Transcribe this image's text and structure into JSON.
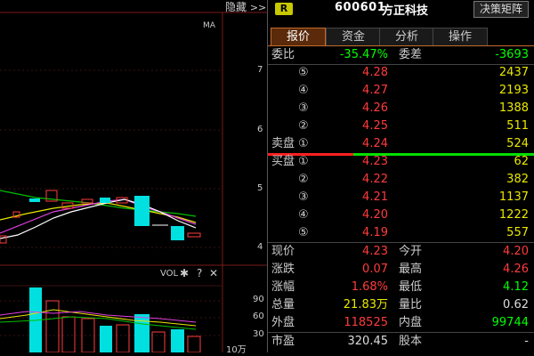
{
  "chart": {
    "hide_label": "隐藏",
    "ma_label": "MA",
    "y_labels": [
      "7",
      "6",
      "5",
      "4"
    ],
    "vol_label": "VOL",
    "vol_y_labels": [
      "90",
      "60",
      "30"
    ],
    "vol_unit": "10万"
  },
  "header": {
    "badge": "R",
    "code": "600601",
    "name": "方正科技",
    "matrix_button": "决策矩阵"
  },
  "tabs": [
    "报价",
    "资金",
    "分析",
    "操作"
  ],
  "order": {
    "ratio_label": "委比",
    "ratio_value": "-35.47%",
    "diff_label": "委差",
    "diff_value": "-3693"
  },
  "asks": [
    {
      "idx": "⑤",
      "price": "4.28",
      "vol": "2437"
    },
    {
      "idx": "④",
      "price": "4.27",
      "vol": "2193"
    },
    {
      "idx": "③",
      "price": "4.26",
      "vol": "1388"
    },
    {
      "idx": "②",
      "price": "4.25",
      "vol": "511"
    },
    {
      "label": "卖盘",
      "idx": "①",
      "price": "4.24",
      "vol": "524"
    }
  ],
  "bids": [
    {
      "label": "买盘",
      "idx": "①",
      "price": "4.23",
      "vol": "62"
    },
    {
      "idx": "②",
      "price": "4.22",
      "vol": "382"
    },
    {
      "idx": "③",
      "price": "4.21",
      "vol": "1137"
    },
    {
      "idx": "④",
      "price": "4.20",
      "vol": "1222"
    },
    {
      "idx": "⑤",
      "price": "4.19",
      "vol": "557"
    }
  ],
  "quote": {
    "current_label": "现价",
    "current_value": "4.23",
    "open_label": "今开",
    "open_value": "4.20",
    "change_label": "涨跌",
    "change_value": "0.07",
    "high_label": "最高",
    "high_value": "4.26",
    "pct_label": "涨幅",
    "pct_value": "1.68%",
    "low_label": "最低",
    "low_value": "4.12",
    "volume_label": "总量",
    "volume_value": "21.83万",
    "vratio_label": "量比",
    "vratio_value": "0.62",
    "outer_label": "外盘",
    "outer_value": "118525",
    "inner_label": "内盘",
    "inner_value": "99744",
    "pe_label": "市盈",
    "pe_value": "320.45",
    "capital_label": "股本",
    "capital_value": "-"
  },
  "colors": {
    "up": "#ff3b3b",
    "down": "#00e0e0",
    "yellow": "#e8e800",
    "green": "#00ff00"
  }
}
